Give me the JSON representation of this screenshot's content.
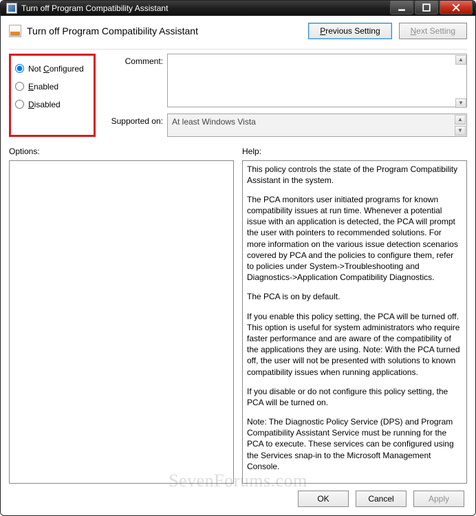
{
  "window": {
    "title": "Turn off Program Compatibility Assistant"
  },
  "header": {
    "policy_title": "Turn off Program Compatibility Assistant",
    "prev_label": "Previous Setting",
    "next_label": "Next Setting"
  },
  "state": {
    "options": [
      {
        "label_pre": "Not ",
        "key": "C",
        "label_post": "onfigured",
        "checked": true
      },
      {
        "label_pre": "",
        "key": "E",
        "label_post": "nabled",
        "checked": false
      },
      {
        "label_pre": "",
        "key": "D",
        "label_post": "isabled",
        "checked": false
      }
    ]
  },
  "labels": {
    "comment": "Comment:",
    "supported": "Supported on:",
    "options_col": "Options:",
    "help_col": "Help:"
  },
  "fields": {
    "comment_value": "",
    "supported_value": "At least Windows Vista"
  },
  "help": {
    "p1": "This policy controls the state of the Program Compatibility Assistant in the system.",
    "p2": "The PCA monitors user initiated programs for known compatibility issues at run time. Whenever a potential issue with an application is detected, the PCA will prompt the user with pointers to recommended solutions.  For more information on the various issue detection scenarios covered by PCA and the policies to configure them, refer to policies under System->Troubleshooting and Diagnostics->Application Compatibility Diagnostics.",
    "p3": "The PCA is on by default.",
    "p4": "If you enable this policy setting, the PCA will be turned off. This option is useful for system administrators who require faster performance and are aware of the compatibility of the applications they are using. Note: With the PCA turned off, the user will not be presented with solutions to known compatibility issues when running applications.",
    "p5": "If you disable or do not configure this policy setting, the PCA will be turned on.",
    "p6": "Note: The Diagnostic Policy Service (DPS) and Program Compatibility Assistant Service must be running for the PCA to execute. These services can be configured using the Services snap-in to the Microsoft Management Console."
  },
  "footer": {
    "ok": "OK",
    "cancel": "Cancel",
    "apply": "Apply"
  },
  "watermark": "SevenForums.com"
}
